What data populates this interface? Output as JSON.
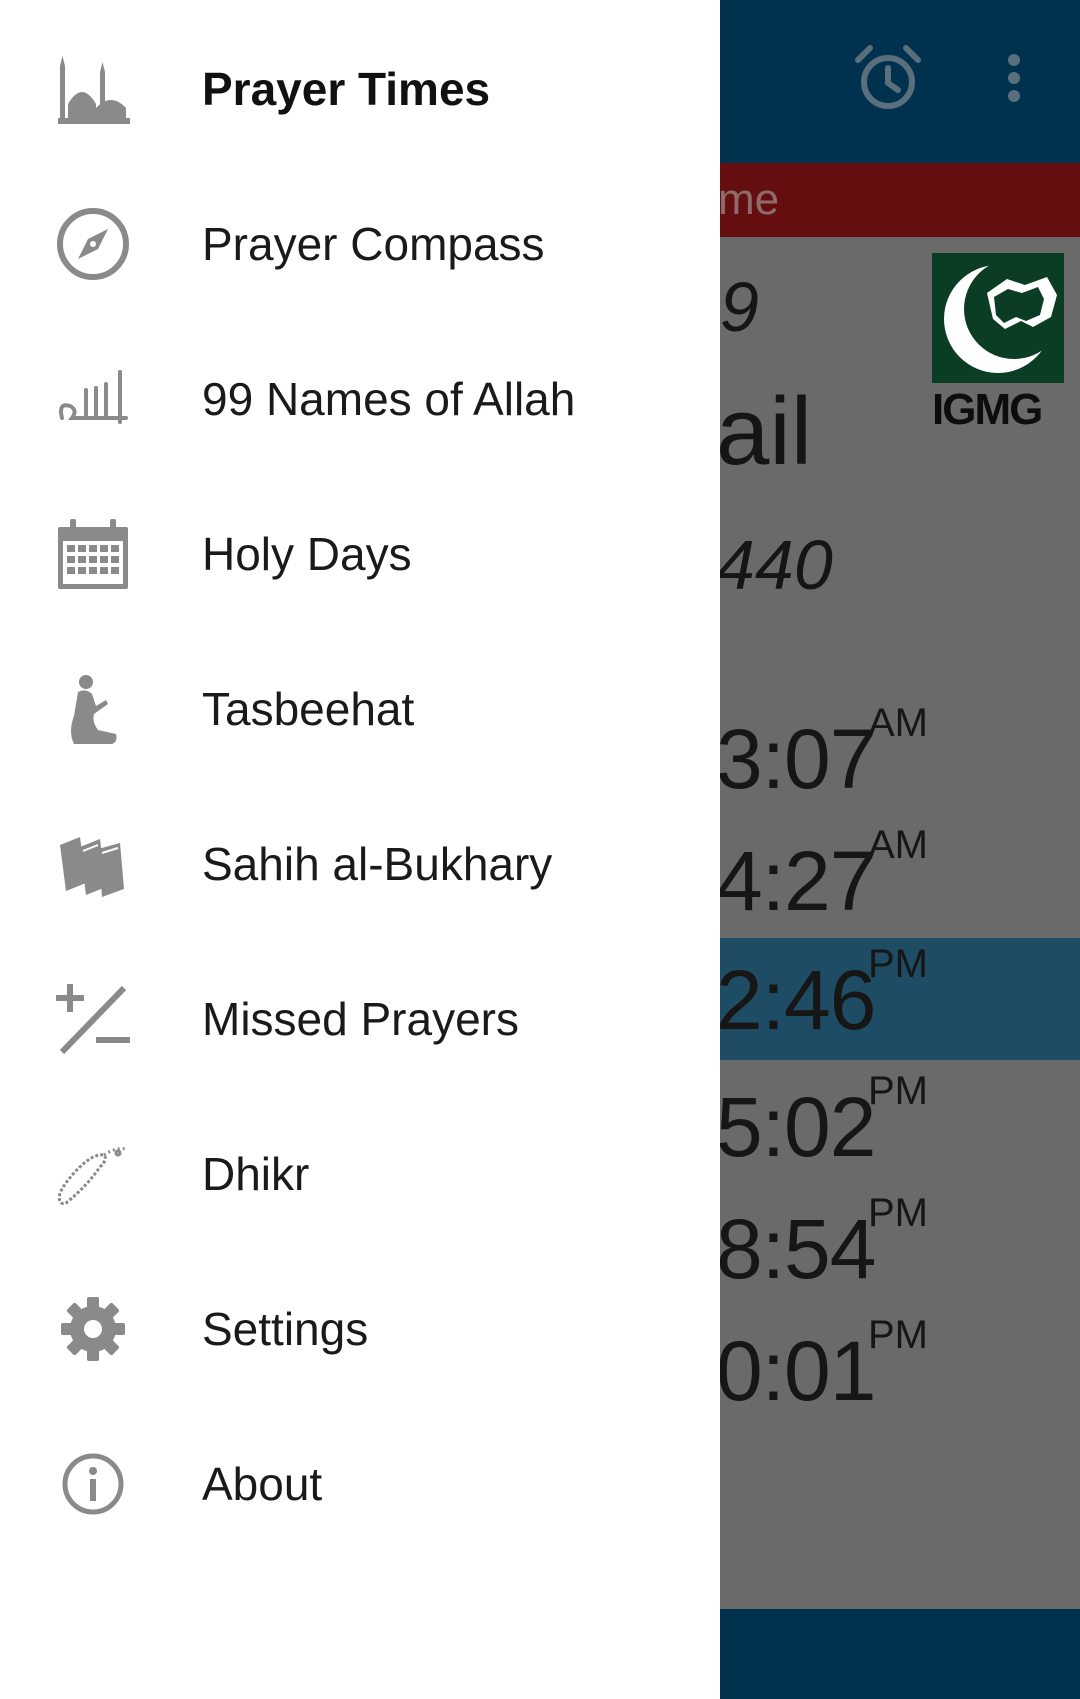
{
  "app_bar": {
    "icons": [
      "alarm-clock-icon",
      "more-vert-icon"
    ]
  },
  "banner": {
    "text": "me"
  },
  "main": {
    "date_fragment": "9",
    "city_fragment": "ail",
    "hijri_fragment": "440",
    "logo_text": "IGMG",
    "times": [
      {
        "time": "3:07",
        "period": "AM",
        "active": false
      },
      {
        "time": "4:27",
        "period": "AM",
        "active": false
      },
      {
        "time": "2:46",
        "period": "PM",
        "active": true
      },
      {
        "time": "5:02",
        "period": "PM",
        "active": false
      },
      {
        "time": "8:54",
        "period": "PM",
        "active": false
      },
      {
        "time": "0:01",
        "period": "PM",
        "active": false
      }
    ]
  },
  "drawer": {
    "items": [
      {
        "label": "Prayer Times",
        "icon": "mosque-icon",
        "selected": true
      },
      {
        "label": "Prayer Compass",
        "icon": "compass-icon",
        "selected": false
      },
      {
        "label": "99 Names of Allah",
        "icon": "allah-calligraphy-icon",
        "selected": false
      },
      {
        "label": "Holy Days",
        "icon": "calendar-icon",
        "selected": false
      },
      {
        "label": "Tasbeehat",
        "icon": "praying-person-icon",
        "selected": false
      },
      {
        "label": "Sahih al-Bukhary",
        "icon": "books-icon",
        "selected": false
      },
      {
        "label": "Missed Prayers",
        "icon": "plus-minus-icon",
        "selected": false
      },
      {
        "label": "Dhikr",
        "icon": "prayer-beads-icon",
        "selected": false
      },
      {
        "label": "Settings",
        "icon": "gear-icon",
        "selected": false
      },
      {
        "label": "About",
        "icon": "info-icon",
        "selected": false
      }
    ]
  },
  "colors": {
    "toolbar": "#00324f",
    "banner": "#650e10",
    "active_row": "#1e4c65",
    "drawer_icon": "#8a8a8a",
    "logo_green": "#0b3d25"
  }
}
